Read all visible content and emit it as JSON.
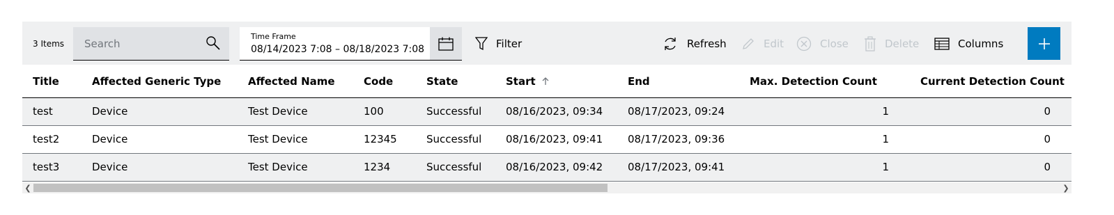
{
  "toolbar": {
    "item_count": "3 Items",
    "search_placeholder": "Search",
    "timeframe_label": "Time Frame",
    "timeframe_value": "08/14/2023 7:08 – 08/18/2023 7:08",
    "filter_label": "Filter",
    "refresh_label": "Refresh",
    "edit_label": "Edit",
    "close_label": "Close",
    "delete_label": "Delete",
    "columns_label": "Columns",
    "add_icon": "plus-icon"
  },
  "table": {
    "headers": {
      "title": "Title",
      "affected_generic_type": "Affected Generic Type",
      "affected_name": "Affected Name",
      "code": "Code",
      "state": "State",
      "start": "Start",
      "end": "End",
      "max_detection_count": "Max. Detection Count",
      "current_detection_count": "Current Detection Count"
    },
    "sort": {
      "column": "Start",
      "direction": "ascending"
    },
    "rows": [
      {
        "title": "test",
        "type": "Device",
        "name": "Test Device",
        "code": "100",
        "state": "Successful",
        "start": "08/16/2023, 09:34",
        "end": "08/17/2023, 09:24",
        "max": "1",
        "current": "0"
      },
      {
        "title": "test2",
        "type": "Device",
        "name": "Test Device",
        "code": "12345",
        "state": "Successful",
        "start": "08/16/2023, 09:41",
        "end": "08/17/2023, 09:36",
        "max": "1",
        "current": "0"
      },
      {
        "title": "test3",
        "type": "Device",
        "name": "Test Device",
        "code": "1234",
        "state": "Successful",
        "start": "08/16/2023, 09:42",
        "end": "08/17/2023, 09:41",
        "max": "1",
        "current": "0"
      }
    ]
  },
  "colors": {
    "accent": "#007bc0",
    "toolbar_bg": "#eff0f1",
    "disabled": "#c1c7cc"
  }
}
